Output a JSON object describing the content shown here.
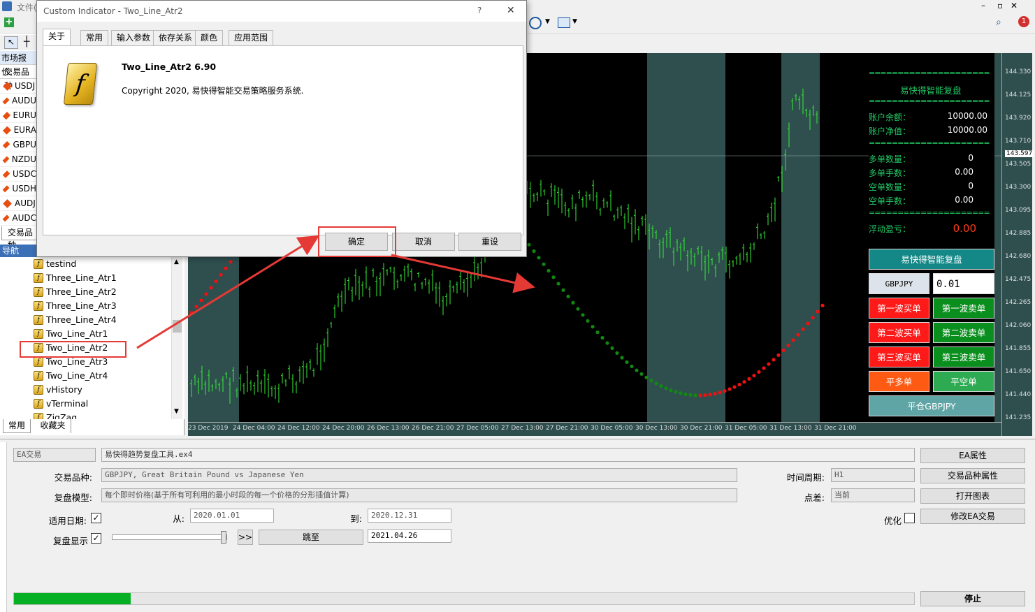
{
  "menubar": {
    "file": "文件("
  },
  "market_watch": {
    "title": "市场报价:",
    "column": "交易品种",
    "symbols": [
      "USDJ",
      "AUDU",
      "EURU",
      "EURA",
      "GBPU",
      "NZDU",
      "USDC",
      "USDH",
      "AUDJ",
      "AUDC"
    ],
    "tab_label": "交易品种"
  },
  "navigator": {
    "title": "导航",
    "items": [
      "testind",
      "Three_Line_Atr1",
      "Three_Line_Atr2",
      "Three_Line_Atr3",
      "Three_Line_Atr4",
      "Two_Line_Atr1",
      "Two_Line_Atr2",
      "Two_Line_Atr3",
      "Two_Line_Atr4",
      "vHistory",
      "vTerminal",
      "ZigZag"
    ],
    "selected": "Two_Line_Atr2",
    "tabs": [
      "常用",
      "收藏夹"
    ]
  },
  "dialog": {
    "title": "Custom Indicator - Two_Line_Atr2",
    "help": "?",
    "close": "✕",
    "tabs": [
      "关于",
      "常用",
      "输入参数",
      "依存关系",
      "颜色",
      "应用范围"
    ],
    "active_tab": "关于",
    "name": "Two_Line_Atr2 6.90",
    "copyright": "Copyright 2020, 易快得智能交易策略服务系统.",
    "logo_letter": "f",
    "buttons": {
      "ok": "确定",
      "cancel": "取消",
      "reset": "重设"
    }
  },
  "chart": {
    "price_labels": [
      "144.330",
      "144.125",
      "143.920",
      "143.710",
      "143.597",
      "143.505",
      "143.300",
      "143.095",
      "142.885",
      "142.680",
      "142.475",
      "142.265",
      "142.060",
      "141.855",
      "141.650",
      "141.440",
      "141.235"
    ],
    "current_price": "143.597",
    "time_labels": [
      "23 Dec 2019",
      "24 Dec 04:00",
      "24 Dec 12:00",
      "24 Dec 20:00",
      "26 Dec 13:00",
      "26 Dec 21:00",
      "27 Dec 05:00",
      "27 Dec 13:00",
      "27 Dec 21:00",
      "30 Dec 05:00",
      "30 Dec 13:00",
      "30 Dec 21:00",
      "31 Dec 05:00",
      "31 Dec 13:00",
      "31 Dec 21:00"
    ],
    "colors": {
      "bg": "#2f4f4f",
      "session": "#000000",
      "candle": "#33ee33",
      "up_dots": "#ee1111",
      "down_dots": "#118811"
    }
  },
  "ea_panel": {
    "separator": "=====================",
    "title": "易快得智能复盘",
    "account_balance_label": "账户余额：",
    "account_balance": "10000.00",
    "account_equity_label": "账户净值：",
    "account_equity": "10000.00",
    "buy_count_label": "多单数量：",
    "buy_count": "0",
    "buy_lots_label": "多单手数：",
    "buy_lots": "0.00",
    "sell_count_label": "空单数量：",
    "sell_count": "0",
    "sell_lots_label": "空单手数：",
    "sell_lots": "0.00",
    "pnl_label": "浮动盈亏：",
    "pnl": "0.00",
    "main_button": "易快得智能复盘",
    "symbol": "GBPJPY",
    "lot": "0.01",
    "buy1": "第一波买单",
    "sell1": "第一波卖单",
    "buy2": "第二波买单",
    "sell2": "第二波卖单",
    "buy3": "第三波买单",
    "sell3": "第三波卖单",
    "close_buy": "平多单",
    "close_sell": "平空单",
    "close_symbol": "平仓GBPJPY"
  },
  "tester": {
    "mode": "EA交易",
    "expert": "易快得趋势复盘工具.ex4",
    "symbol_label": "交易品种:",
    "symbol_value": "GBPJPY, Great Britain Pound vs Japanese Yen",
    "model_label": "复盘模型:",
    "model_value": "每个即时价格(基于所有可利用的最小时段的每一个价格的分形插值计算)",
    "use_date_label": "适用日期:",
    "from_label": "从:",
    "from_value": "2020.01.01",
    "to_label": "到:",
    "to_value": "2020.12.31",
    "visual_label": "复盘显示",
    "skip_button": "跳至",
    "skip_date": "2021.04.26",
    "fast_button": ">>",
    "period_label": "时间周期:",
    "period_value": "H1",
    "spread_label": "点差:",
    "spread_value": "当前",
    "optimize_label": "优化",
    "progress": 0.13,
    "buttons": {
      "expert_props": "EA属性",
      "symbol_props": "交易品种属性",
      "open_chart": "打开图表",
      "modify_expert": "修改EA交易",
      "stop": "停止"
    }
  }
}
